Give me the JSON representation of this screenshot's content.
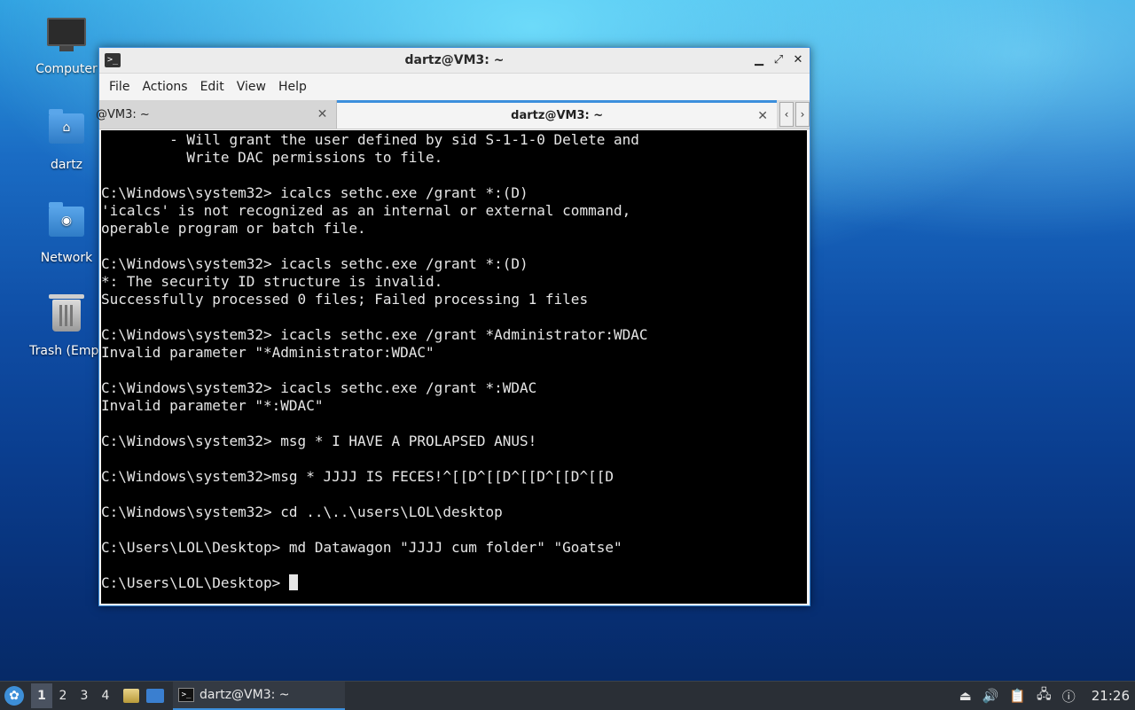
{
  "desktop": {
    "icons": [
      {
        "label": "Computer"
      },
      {
        "label": "dartz"
      },
      {
        "label": "Network"
      },
      {
        "label": "Trash (Empt"
      }
    ]
  },
  "window": {
    "title": "dartz@VM3: ~",
    "controls": {
      "minimize": "▁",
      "maximize": "⤢",
      "close": "✕"
    },
    "menu": [
      "File",
      "Actions",
      "Edit",
      "View",
      "Help"
    ],
    "tabs": [
      {
        "label": "@VM3: ~",
        "close": "✕"
      },
      {
        "label": "dartz@VM3: ~",
        "close": "✕"
      }
    ],
    "tab_nav": {
      "prev": "‹",
      "next": "›"
    }
  },
  "terminal": {
    "lines": [
      "        - Will grant the user defined by sid S-1-1-0 Delete and",
      "          Write DAC permissions to file.",
      "",
      "C:\\Windows\\system32> icalcs sethc.exe /grant *:(D)",
      "'icalcs' is not recognized as an internal or external command,",
      "operable program or batch file.",
      "",
      "C:\\Windows\\system32> icacls sethc.exe /grant *:(D)",
      "*: The security ID structure is invalid.",
      "Successfully processed 0 files; Failed processing 1 files",
      "",
      "C:\\Windows\\system32> icacls sethc.exe /grant *Administrator:WDAC",
      "Invalid parameter \"*Administrator:WDAC\"",
      "",
      "C:\\Windows\\system32> icacls sethc.exe /grant *:WDAC",
      "Invalid parameter \"*:WDAC\"",
      "",
      "C:\\Windows\\system32> msg * I HAVE A PROLAPSED ANUS!",
      "",
      "C:\\Windows\\system32>msg * JJJJ IS FECES!^[[D^[[D^[[D^[[D^[[D",
      "",
      "C:\\Windows\\system32> cd ..\\..\\users\\LOL\\desktop",
      "",
      "C:\\Users\\LOL\\Desktop> md Datawagon \"JJJJ cum folder\" \"Goatse\"",
      ""
    ],
    "prompt": "C:\\Users\\LOL\\Desktop> "
  },
  "taskbar": {
    "workspaces": [
      "1",
      "2",
      "3",
      "4"
    ],
    "active_task": "dartz@VM3: ~",
    "clock": "21:26",
    "accent_color": "#3c8fdc"
  }
}
